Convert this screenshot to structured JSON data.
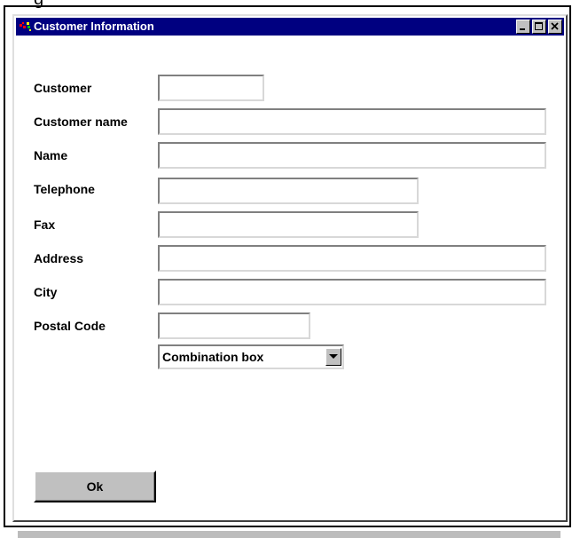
{
  "window": {
    "title": "Customer Information"
  },
  "form": {
    "fields": [
      {
        "label": "Customer",
        "value": ""
      },
      {
        "label": "Customer name",
        "value": ""
      },
      {
        "label": "Name",
        "value": ""
      },
      {
        "label": "Telephone",
        "value": ""
      },
      {
        "label": "Fax",
        "value": ""
      },
      {
        "label": "Address",
        "value": ""
      },
      {
        "label": "City",
        "value": ""
      },
      {
        "label": "Postal Code",
        "value": ""
      }
    ],
    "combo": {
      "selected": "Combination box"
    },
    "ok_label": "Ok"
  },
  "icons": {
    "app": "app-icon",
    "minimize": "minimize-icon",
    "maximize": "maximize-icon",
    "close": "close-icon",
    "dropdown": "chevron-down-icon"
  },
  "colors": {
    "titlebar": "#000080",
    "face": "#c0c0c0"
  }
}
